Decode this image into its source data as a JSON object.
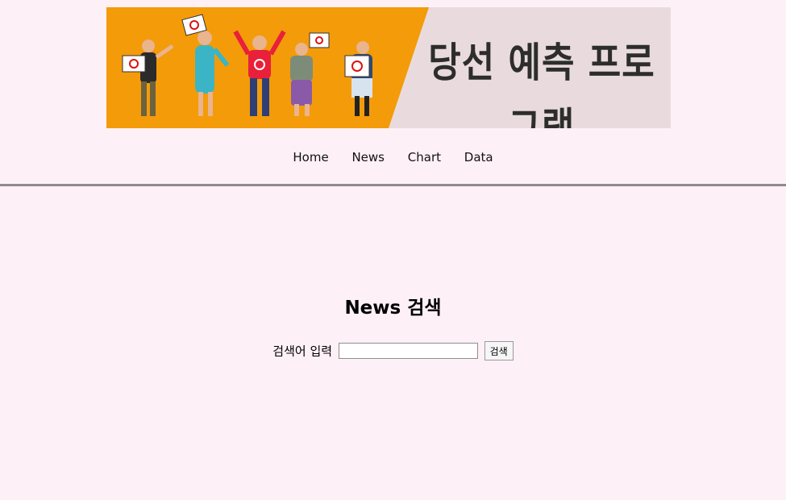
{
  "banner": {
    "title": "당선 예측 프로그램"
  },
  "nav": {
    "items": [
      "Home",
      "News",
      "Chart",
      "Data"
    ]
  },
  "main": {
    "heading": "News 검색",
    "search_label": "검색어 입력",
    "search_value": "",
    "search_button": "검색"
  }
}
